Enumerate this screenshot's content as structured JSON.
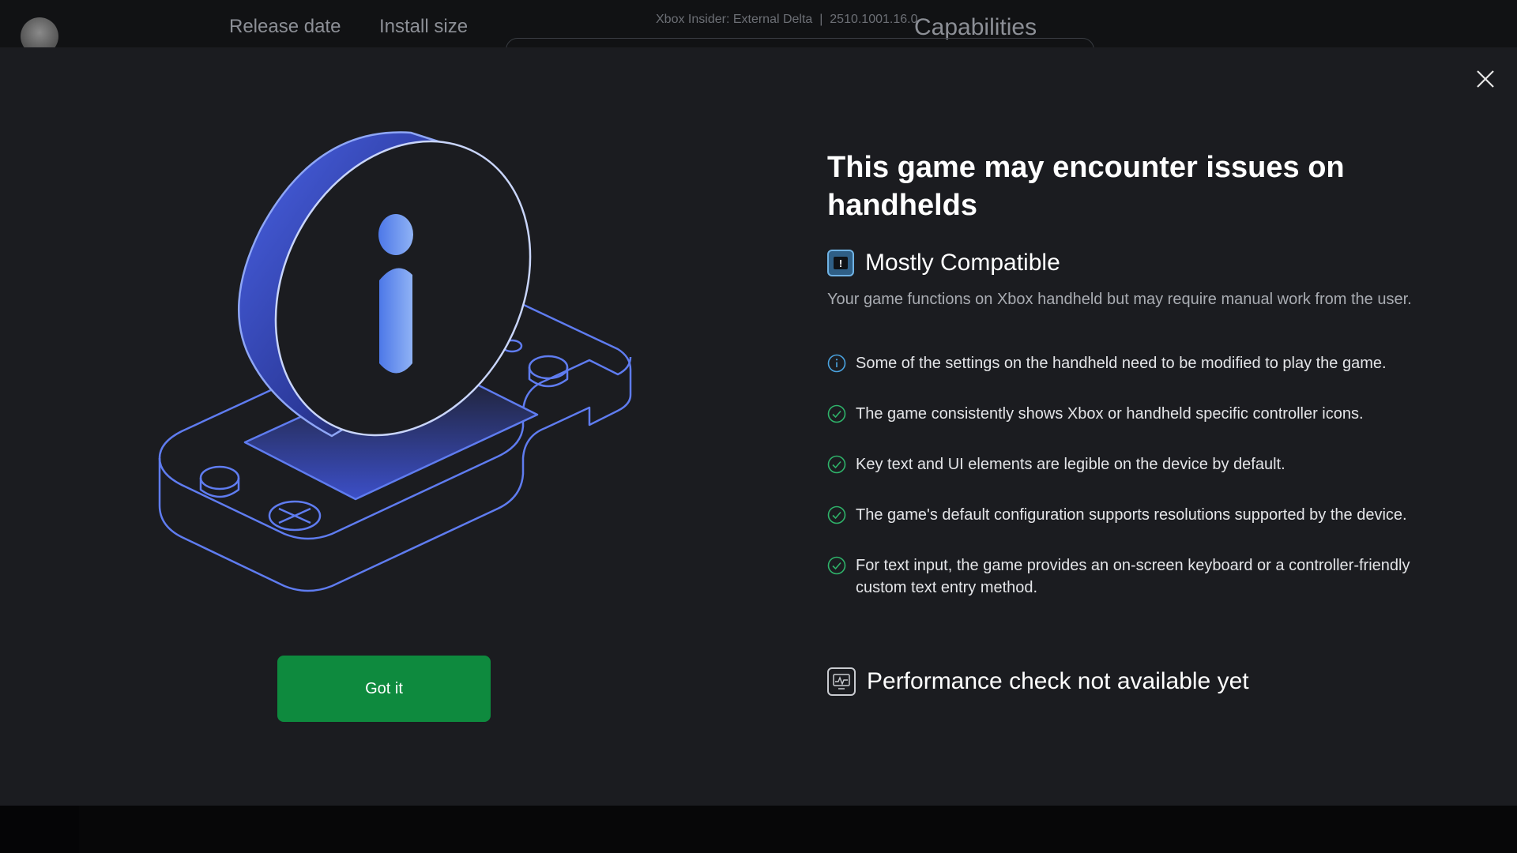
{
  "background": {
    "tabs": [
      "Release date",
      "Install size"
    ],
    "insider_label": "Xbox Insider: External Delta",
    "version": "2510.1001.16.0",
    "capabilities_heading": "Capabilities"
  },
  "modal": {
    "title": "This game may encounter issues on handhelds",
    "compatibility": {
      "label": "Mostly Compatible",
      "icon": "warning-badge-icon",
      "description": "Your game functions on Xbox handheld but may require manual work from the user."
    },
    "requirements": [
      {
        "status": "info",
        "icon": "info-circle-icon",
        "text": "Some of the settings on the handheld need to be modified to play the game."
      },
      {
        "status": "pass",
        "icon": "check-circle-icon",
        "text": "The game consistently shows Xbox or handheld specific controller icons."
      },
      {
        "status": "pass",
        "icon": "check-circle-icon",
        "text": "Key text and UI elements are legible on the device by default."
      },
      {
        "status": "pass",
        "icon": "check-circle-icon",
        "text": "The game's default configuration supports resolutions supported by the device."
      },
      {
        "status": "pass",
        "icon": "check-circle-icon",
        "text": "For text input, the game provides an on-screen keyboard or a controller-friendly custom text entry method."
      }
    ],
    "performance": {
      "label": "Performance check not available yet",
      "icon": "performance-monitor-icon"
    },
    "got_it_label": "Got it",
    "close_icon": "close-icon"
  },
  "colors": {
    "modal_bg": "#1b1c20",
    "accent_green": "#0e8a3e",
    "info_blue": "#4aa3e0",
    "check_green": "#2fb36a",
    "illustration_blue": "#5f7cf0"
  }
}
